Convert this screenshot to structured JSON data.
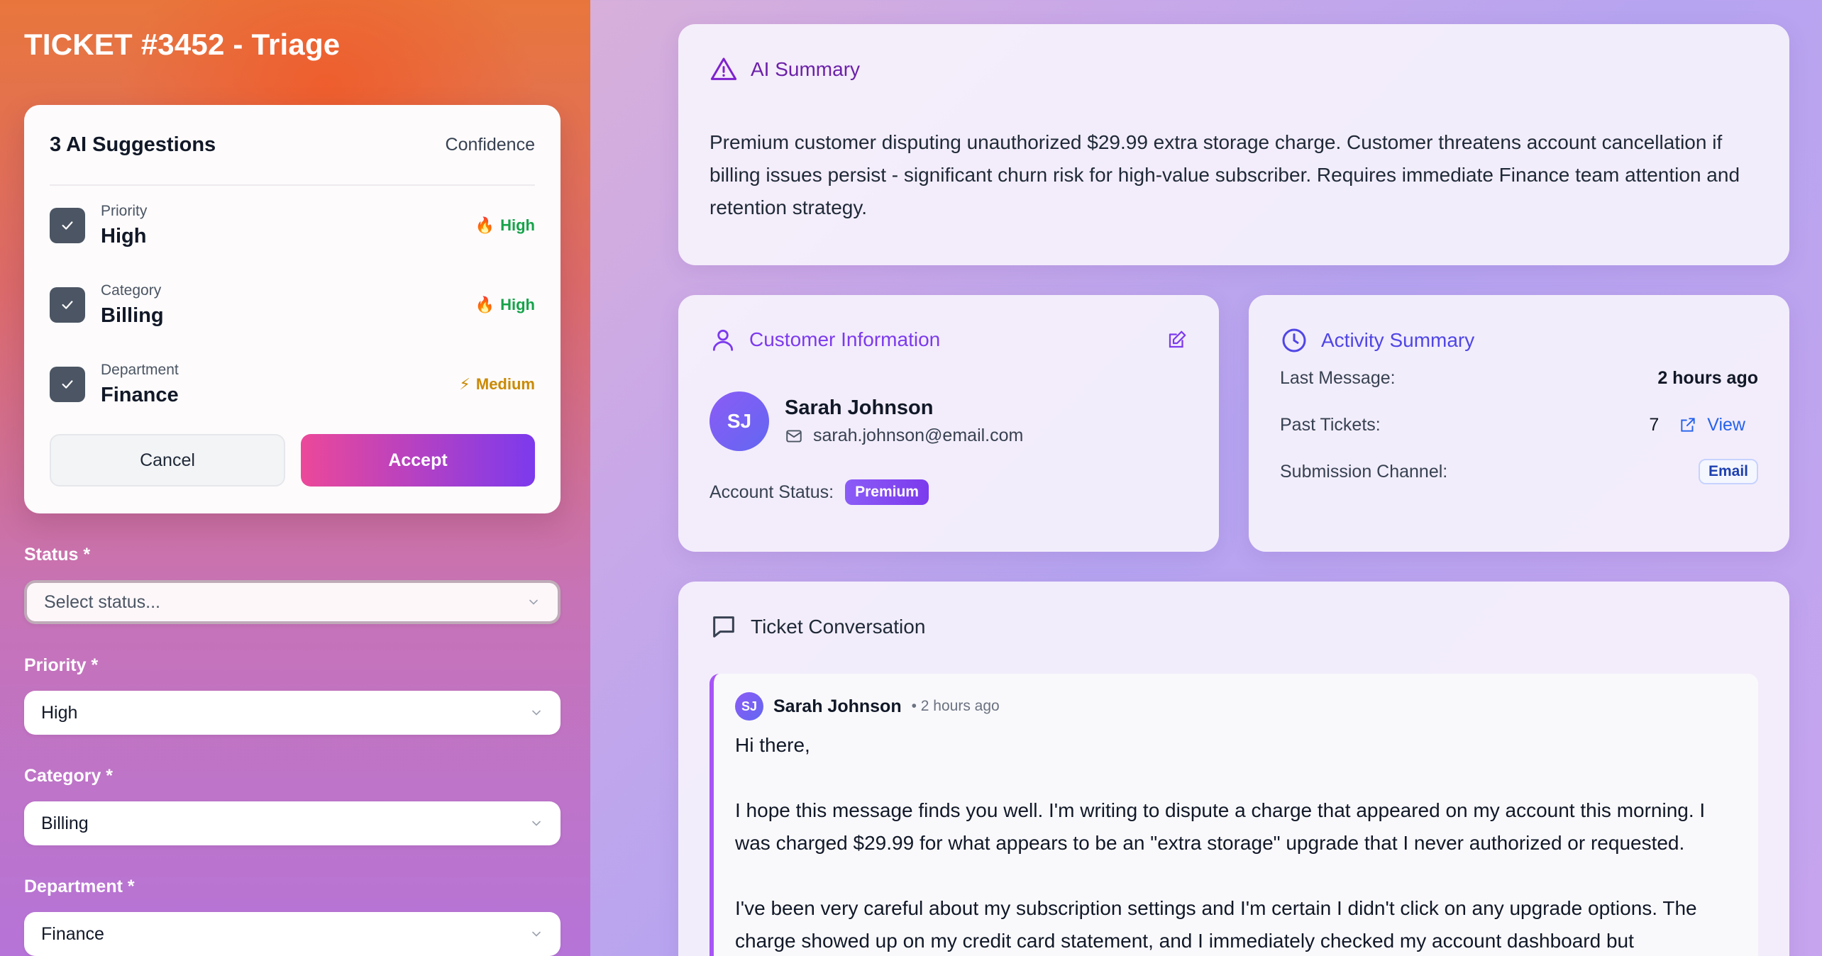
{
  "ticket": {
    "title": "TICKET #3452 - Triage"
  },
  "suggestions": {
    "heading": "3 AI Suggestions",
    "confidence_label": "Confidence",
    "items": [
      {
        "label": "Priority",
        "value": "High",
        "confidence": "High",
        "confidence_icon": "fire-icon",
        "confidence_color": "#16a34a"
      },
      {
        "label": "Category",
        "value": "Billing",
        "confidence": "High",
        "confidence_icon": "fire-icon",
        "confidence_color": "#16a34a"
      },
      {
        "label": "Department",
        "value": "Finance",
        "confidence": "Medium",
        "confidence_icon": "lightning-icon",
        "confidence_color": "#ca8a04"
      }
    ],
    "cancel_label": "Cancel",
    "accept_label": "Accept"
  },
  "form": {
    "status": {
      "label": "Status *",
      "placeholder": "Select status..."
    },
    "priority": {
      "label": "Priority *",
      "value": "High"
    },
    "category": {
      "label": "Category *",
      "value": "Billing"
    },
    "department": {
      "label": "Department *",
      "value": "Finance"
    }
  },
  "ai_summary": {
    "title": "AI Summary",
    "text": "Premium customer disputing unauthorized $29.99 extra storage charge. Customer threatens account cancellation if billing issues persist - significant churn risk for high-value subscriber. Requires immediate Finance team attention and retention strategy."
  },
  "customer": {
    "title": "Customer Information",
    "initials": "SJ",
    "name": "Sarah Johnson",
    "email": "sarah.johnson@email.com",
    "account_status_label": "Account Status:",
    "account_status": "Premium"
  },
  "activity": {
    "title": "Activity Summary",
    "last_message_label": "Last Message:",
    "last_message": "2 hours ago",
    "past_tickets_label": "Past Tickets:",
    "past_tickets": "7",
    "view_label": "View",
    "channel_label": "Submission Channel:",
    "channel": "Email"
  },
  "conversation": {
    "title": "Ticket Conversation",
    "message": {
      "initials": "SJ",
      "author": "Sarah Johnson",
      "time": "• 2 hours ago",
      "greeting": "Hi there,",
      "para1": "I hope this message finds you well. I'm writing to dispute a charge that appeared on my account this morning. I was charged $29.99 for what appears to be an \"extra storage\" upgrade that I never authorized or requested.",
      "para2": "I've been very careful about my subscription settings and I'm certain I didn't click on any upgrade options. The charge showed up on my credit card statement, and I immediately checked my account dashboard but"
    }
  },
  "colors": {
    "accent": "#7c3aed",
    "accept_gradient_start": "#ec4899",
    "accept_gradient_end": "#7c3aed"
  }
}
